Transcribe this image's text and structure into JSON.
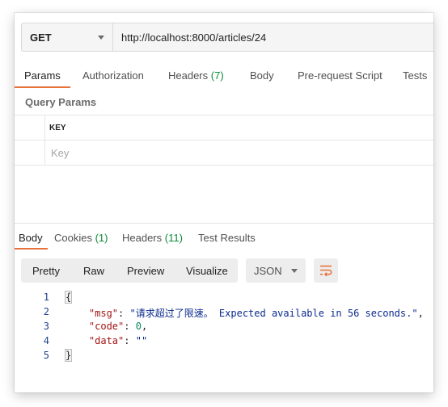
{
  "request": {
    "method": "GET",
    "url": "http://localhost:8000/articles/24"
  },
  "request_tabs": [
    {
      "label": "Params",
      "count": ""
    },
    {
      "label": "Authorization",
      "count": ""
    },
    {
      "label": "Headers",
      "count": "(7)"
    },
    {
      "label": "Body",
      "count": ""
    },
    {
      "label": "Pre-request Script",
      "count": ""
    },
    {
      "label": "Tests",
      "count": ""
    }
  ],
  "params": {
    "section_title": "Query Params",
    "header_key": "KEY",
    "placeholder_key": "Key"
  },
  "response_tabs": [
    {
      "label": "Body",
      "count": ""
    },
    {
      "label": "Cookies",
      "count": "(1)"
    },
    {
      "label": "Headers",
      "count": "(11)"
    },
    {
      "label": "Test Results",
      "count": ""
    }
  ],
  "view_modes": [
    "Pretty",
    "Raw",
    "Preview",
    "Visualize"
  ],
  "format": "JSON",
  "code": {
    "line_numbers": [
      "1",
      "2",
      "3",
      "4",
      "5"
    ],
    "open_brace": "{",
    "close_brace": "}",
    "msg_key": "\"msg\"",
    "msg_value": "\"请求超过了限速。 Expected available in 56 seconds.\"",
    "code_key": "\"code\"",
    "code_value": "0",
    "data_key": "\"data\"",
    "data_value": "\"\""
  },
  "colors": {
    "accent": "#e8723c",
    "count_green": "#0a8a37"
  },
  "icons": {
    "wrap": "wrap-lines-icon",
    "dropdown": "chevron-down-icon"
  }
}
